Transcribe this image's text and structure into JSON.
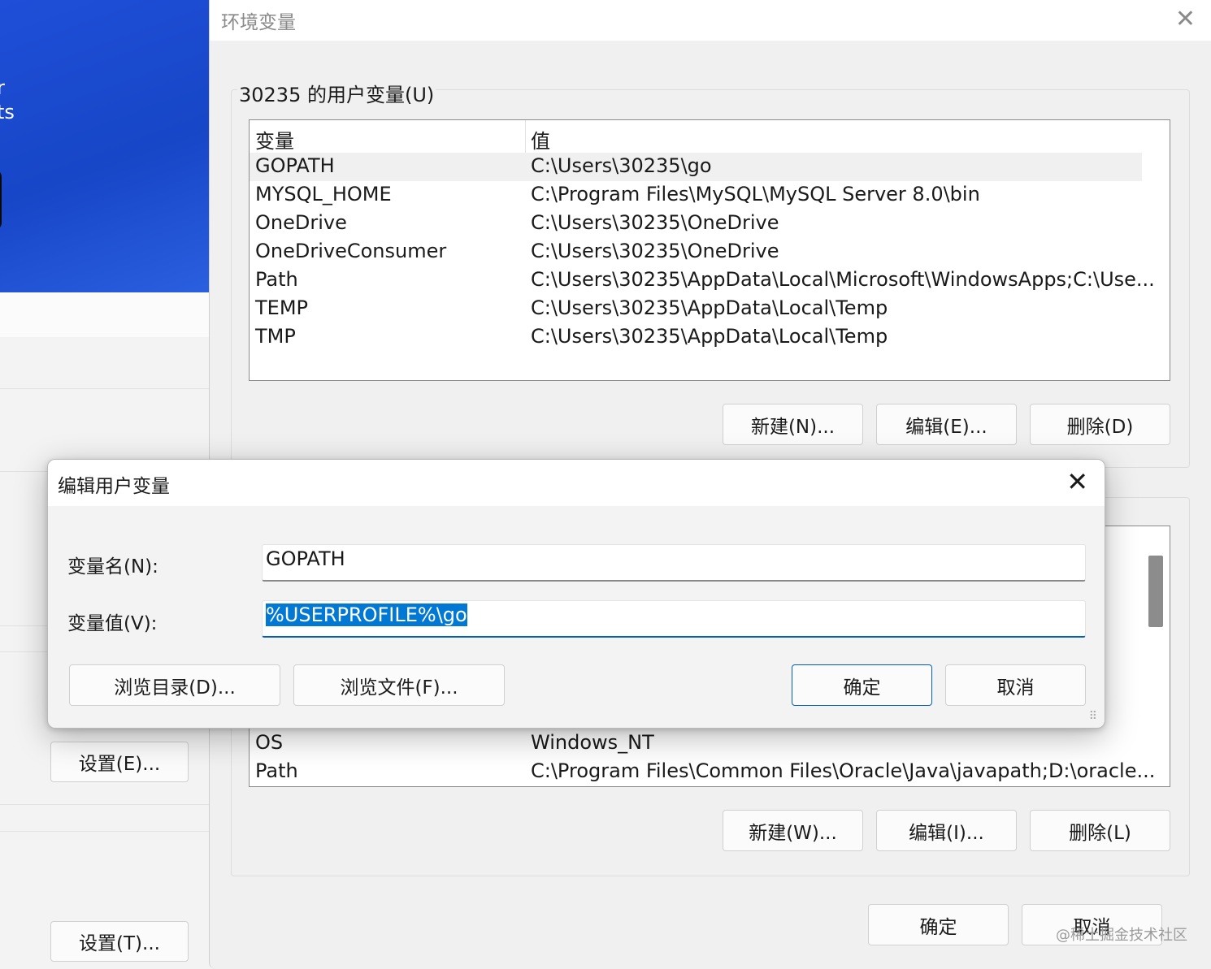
{
  "background": {
    "wallpaper_text": [
      "r",
      "ts"
    ],
    "buttons": {
      "settings_e": "设置(E)...",
      "settings_t": "设置(T)..."
    }
  },
  "env_window": {
    "title": "环境变量",
    "user_group_label": "30235 的用户变量(U)",
    "columns": {
      "name": "变量",
      "value": "值"
    },
    "user_variables": [
      {
        "name": "GOPATH",
        "value": "C:\\Users\\30235\\go"
      },
      {
        "name": "MYSQL_HOME",
        "value": "C:\\Program Files\\MySQL\\MySQL Server 8.0\\bin"
      },
      {
        "name": "OneDrive",
        "value": "C:\\Users\\30235\\OneDrive"
      },
      {
        "name": "OneDriveConsumer",
        "value": "C:\\Users\\30235\\OneDrive"
      },
      {
        "name": "Path",
        "value": "C:\\Users\\30235\\AppData\\Local\\Microsoft\\WindowsApps;C:\\Use..."
      },
      {
        "name": "TEMP",
        "value": "C:\\Users\\30235\\AppData\\Local\\Temp"
      },
      {
        "name": "TMP",
        "value": "C:\\Users\\30235\\AppData\\Local\\Temp"
      }
    ],
    "user_buttons": {
      "new": "新建(N)...",
      "edit": "编辑(E)...",
      "delete": "删除(D)"
    },
    "system_variables_visible": [
      {
        "name": "OS",
        "value": "Windows_NT"
      },
      {
        "name": "Path",
        "value": "C:\\Program Files\\Common Files\\Oracle\\Java\\javapath;D:\\oracle..."
      }
    ],
    "system_buttons": {
      "new": "新建(W)...",
      "edit": "编辑(I)...",
      "delete": "删除(L)"
    },
    "ok": "确定",
    "cancel": "取消"
  },
  "edit_dialog": {
    "title": "编辑用户变量",
    "name_label": "变量名(N):",
    "name_value": "GOPATH",
    "value_label": "变量值(V):",
    "value_value": "%USERPROFILE%\\go",
    "browse_dir": "浏览目录(D)...",
    "browse_file": "浏览文件(F)...",
    "ok": "确定",
    "cancel": "取消"
  },
  "watermark": "@稀土掘金技术社区",
  "colors": {
    "accent": "#0078d4",
    "focus_border": "#005fb8",
    "wallpaper": "#1f4fd8"
  }
}
